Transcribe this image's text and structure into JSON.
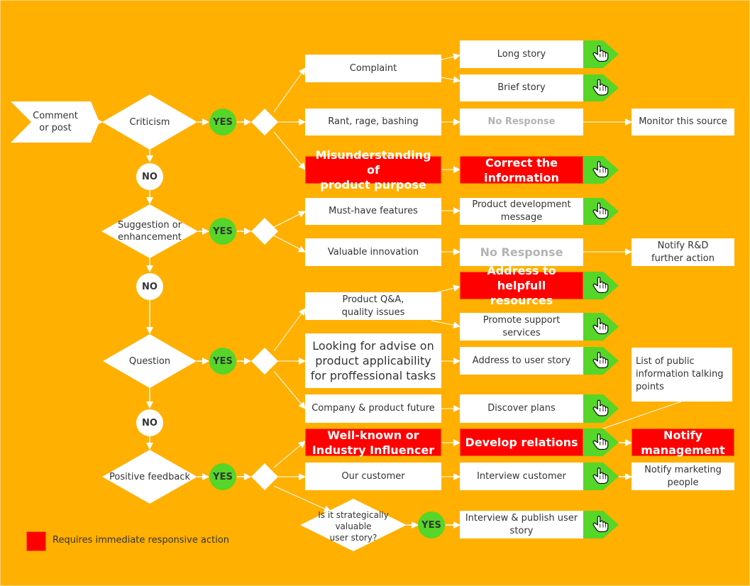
{
  "colors": {
    "background": "#FFB000",
    "action_green": "#55D628",
    "urgent_red": "#FF0000",
    "box_white": "#FFFFFF",
    "muted_text": "#B3B3B3"
  },
  "start": {
    "label": "Comment\nor post"
  },
  "decisions": {
    "criticism": "Criticism",
    "suggestion": "Suggestion or\nenhancement",
    "question": "Question",
    "positive": "Positive feedback",
    "strategic": "Is it strategically\nvaluable\nuser story?"
  },
  "yes_label": "YES",
  "no_label": "NO",
  "categories": {
    "complaint": "Complaint",
    "rant": "Rant, rage, bashing",
    "misunderstanding": "Misunderstanding of\nproduct purpose",
    "must_have": "Must-have features",
    "valuable_innovation": "Valuable innovation",
    "product_qa": "Product Q&A,\nquality issues",
    "looking_advise": "Looking for advise on\nproduct applicability\nfor proffessional tasks",
    "company_future": "Company & product future",
    "influencer": "Well-known or\nIndustry Influencer",
    "our_customer": "Our customer"
  },
  "responses": {
    "long_story": "Long story",
    "brief_story": "Brief story",
    "no_response_1": "No Response",
    "correct_info": "Correct the\ninformation",
    "product_dev_message": "Product development\nmessage",
    "no_response_2": "No Response",
    "address_resources": "Address to helpfull\nresources",
    "promote_support": "Promote support\nservices",
    "address_user_story": "Address to user story",
    "discover_plans": "Discover plans",
    "develop_relations": "Develop relations",
    "interview_customer": "Interview customer",
    "interview_publish": "Interview & publish user\nstory"
  },
  "followups": {
    "monitor_source": "Monitor this source",
    "notify_rd": "Notify R&D\nfurther action",
    "talking_points": "List of public\ninformation talking\npoints",
    "notify_management": "Notify\nmanagement",
    "notify_marketing": "Notify marketing\npeople"
  },
  "action_icon": "pointer-hand-icon",
  "legend": {
    "label": "Requires immediate responsive action"
  }
}
